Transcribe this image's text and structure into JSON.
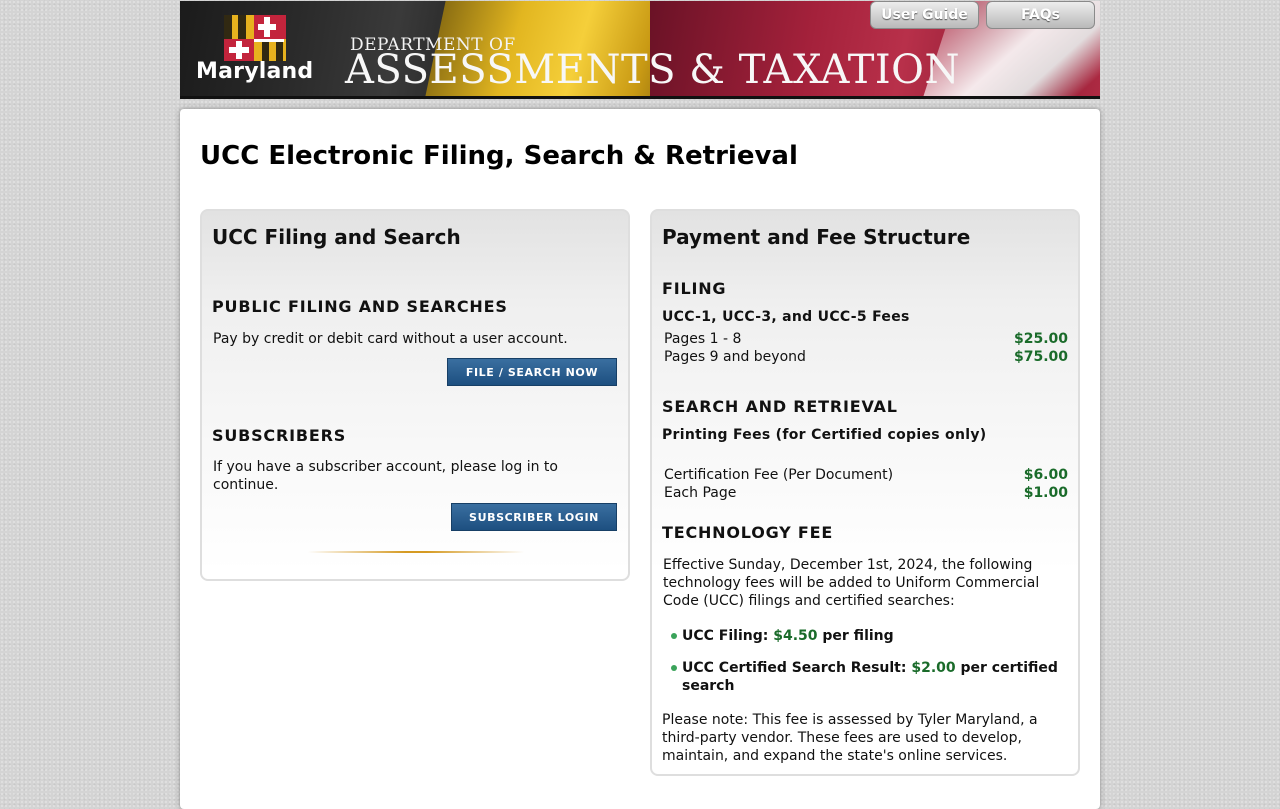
{
  "header": {
    "logo_text": "Maryland",
    "dept_line1": "DEPARTMENT OF",
    "dept_line2": "ASSESSMENTS & TAXATION",
    "buttons": {
      "user_guide": "User Guide",
      "faqs": "FAQs"
    }
  },
  "page_title": "UCC Electronic Filing, Search & Retrieval",
  "left_panel": {
    "title": "UCC Filing and Search",
    "public": {
      "heading": "PUBLIC FILING AND SEARCHES",
      "text": "Pay by credit or debit card without a user account.",
      "button": "FILE / SEARCH NOW"
    },
    "subscribers": {
      "heading": "SUBSCRIBERS",
      "text": "If you have a subscriber account, please log in to continue.",
      "button": "SUBSCRIBER LOGIN"
    }
  },
  "right_panel": {
    "title": "Payment and Fee Structure",
    "filing": {
      "heading": "FILING",
      "subheading": "UCC-1, UCC-3, and UCC-5 Fees",
      "rows": [
        {
          "label": "Pages 1 - 8",
          "amount": "$25.00"
        },
        {
          "label": "Pages 9 and beyond",
          "amount": "$75.00"
        }
      ]
    },
    "search": {
      "heading": "SEARCH AND RETRIEVAL",
      "subheading": "Printing Fees (for Certified copies only)",
      "rows": [
        {
          "label": "Certification Fee (Per Document)",
          "amount": "$6.00"
        },
        {
          "label": "Each Page",
          "amount": "$1.00"
        }
      ]
    },
    "technology": {
      "heading": "TECHNOLOGY FEE",
      "intro": "Effective Sunday, December 1st, 2024, the following technology fees will be added to Uniform Commercial Code (UCC) filings and certified searches:",
      "items": [
        {
          "label": "UCC Filing:",
          "amount": "$4.50",
          "suffix": "per filing"
        },
        {
          "label": "UCC Certified Search Result:",
          "amount": "$2.00",
          "suffix": "per certified search"
        }
      ],
      "note": "Please note: This fee is assessed by Tyler Maryland, a third-party vendor. These fees are used to develop, maintain, and expand the state's online services."
    }
  },
  "colors": {
    "fee_green": "#1a6b2a",
    "button_blue": "#1d4f80",
    "bullet_green": "#3aa35a"
  }
}
